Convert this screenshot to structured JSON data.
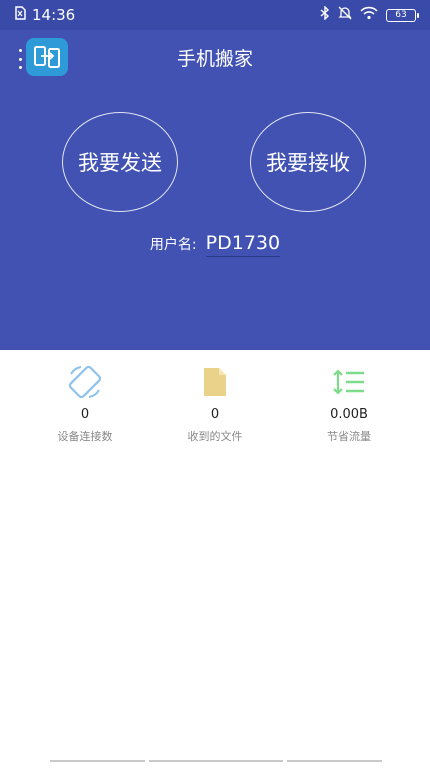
{
  "status": {
    "time": "14:36",
    "battery": "63",
    "icons": [
      "sim-icon",
      "bluetooth-icon",
      "mute-icon",
      "wifi-icon",
      "battery-icon"
    ]
  },
  "header": {
    "title": "手机搬家",
    "logo_icon": "phone-transfer-icon"
  },
  "actions": {
    "send_label": "我要发送",
    "receive_label": "我要接收"
  },
  "user": {
    "label": "用户名:",
    "name": "PD1730"
  },
  "stats": [
    {
      "value": "0",
      "label": "设备连接数",
      "icon": "rotate-device-icon",
      "color": "#8cc2ec"
    },
    {
      "value": "0",
      "label": "收到的文件",
      "icon": "file-icon",
      "color": "#ebd28a"
    },
    {
      "value": "0.00B",
      "label": "节省流量",
      "icon": "sort-list-icon",
      "color": "#7ddc8a"
    }
  ],
  "colors": {
    "primary": "#4152b3",
    "status_bar": "#3a4aa8"
  }
}
